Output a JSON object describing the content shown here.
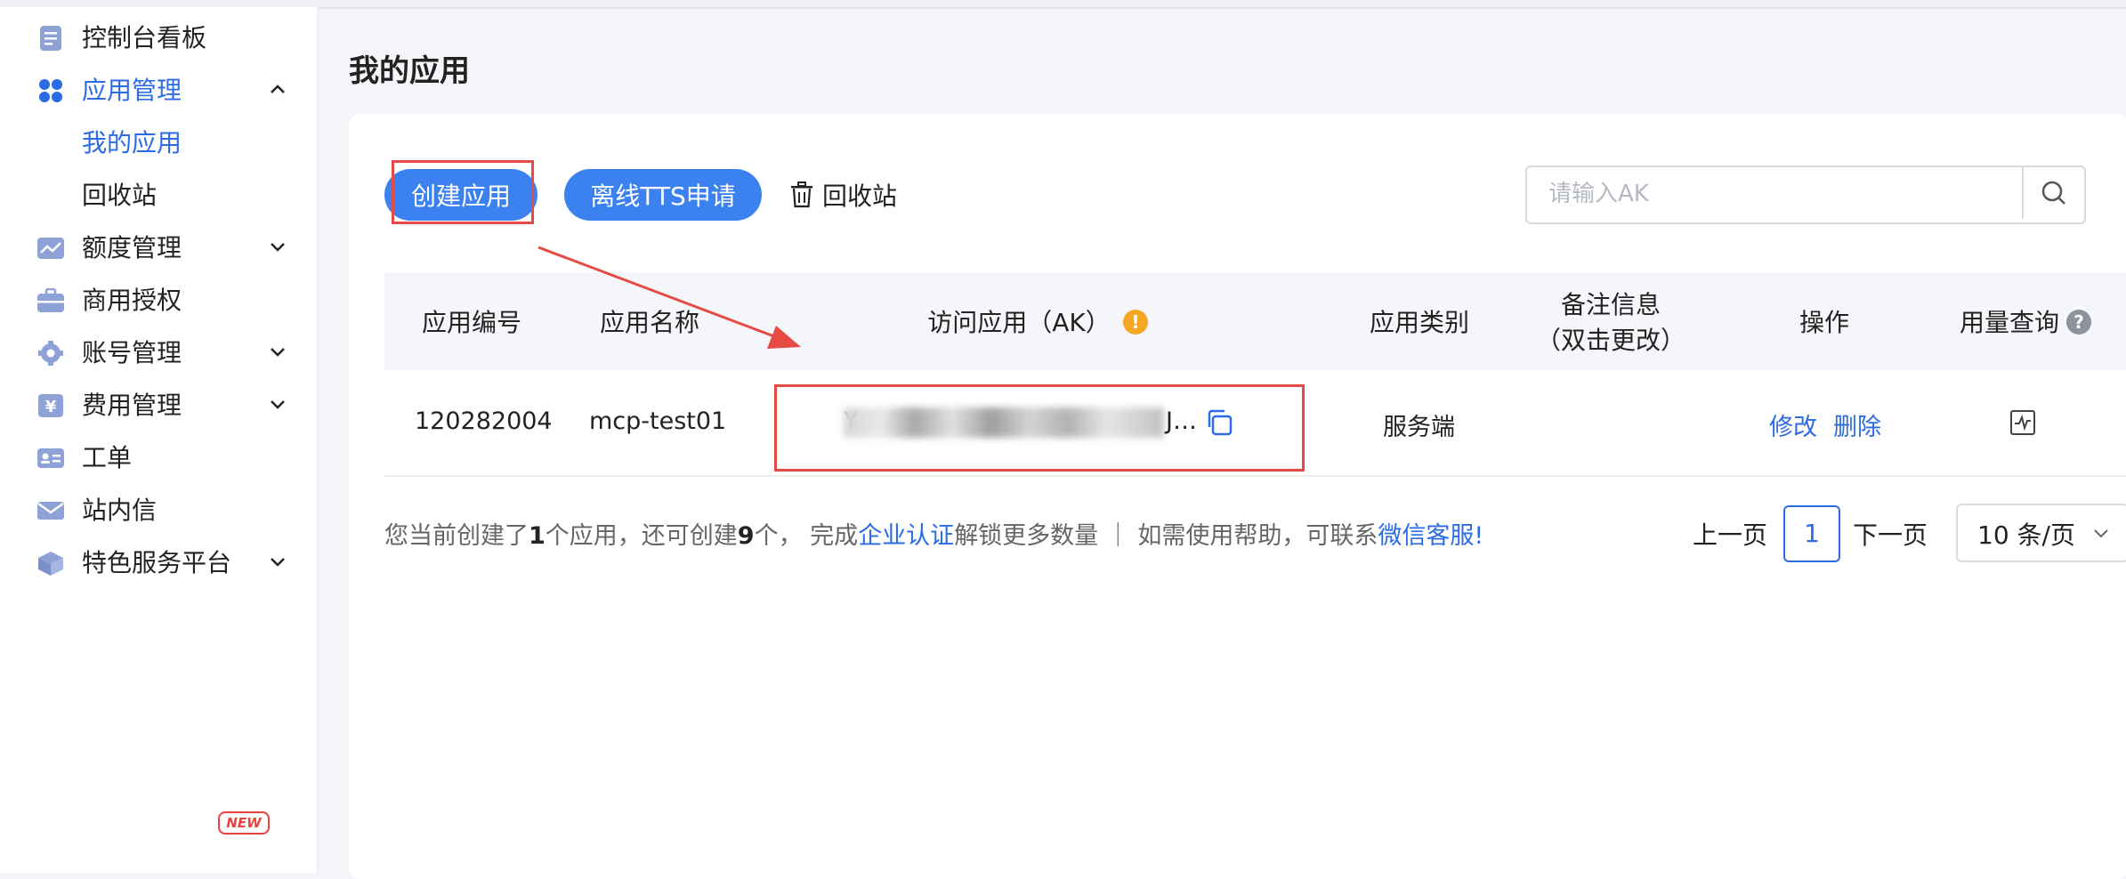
{
  "sidebar": {
    "items": [
      {
        "label": "控制台看板",
        "icon": "dashboard-doc-icon"
      },
      {
        "label": "应用管理",
        "icon": "apps-grid-icon",
        "expanded": true,
        "active": true
      },
      {
        "label": "额度管理",
        "icon": "chart-line-icon"
      },
      {
        "label": "商用授权",
        "icon": "briefcase-icon"
      },
      {
        "label": "账号管理",
        "icon": "gear-icon"
      },
      {
        "label": "费用管理",
        "icon": "yen-icon"
      },
      {
        "label": "工单",
        "icon": "id-card-icon"
      },
      {
        "label": "站内信",
        "icon": "mail-icon"
      },
      {
        "label": "特色服务平台",
        "icon": "cube-icon",
        "badge": "NEW"
      }
    ],
    "sub_items": [
      {
        "label": "我的应用",
        "active": true
      },
      {
        "label": "回收站"
      }
    ]
  },
  "page": {
    "title": "我的应用"
  },
  "toolbar": {
    "create_label": "创建应用",
    "tts_label": "离线TTS申请",
    "recycle_label": "回收站",
    "search_placeholder": "请输入AK"
  },
  "table": {
    "headers": {
      "app_id": "应用编号",
      "app_name": "应用名称",
      "ak": "访问应用（AK）",
      "category": "应用类别",
      "note_line1": "备注信息",
      "note_line2": "（双击更改）",
      "actions": "操作",
      "usage": "用量查询"
    },
    "rows": [
      {
        "app_id": "120282004",
        "app_name": "mcp-test01",
        "ak_prefix": "Y",
        "ak_suffix": "J…",
        "category": "服务端",
        "edit": "修改",
        "delete": "删除"
      }
    ]
  },
  "footer": {
    "t1": "您当前创建了",
    "n1": "1",
    "t2": "个应用，还可创建",
    "n2": "9",
    "t3": "个，  完成",
    "link1": "企业认证",
    "t4": "解锁更多数量  ｜  如需使用帮助，可联系",
    "link2": "微信客服!",
    "prev": "上一页",
    "current_page": "1",
    "next": "下一页",
    "page_size": "10 条/页"
  },
  "colors": {
    "accent": "#2b6be6",
    "button": "#3b82f0",
    "annotation_red": "#e64a45",
    "warning": "#f5a623"
  }
}
